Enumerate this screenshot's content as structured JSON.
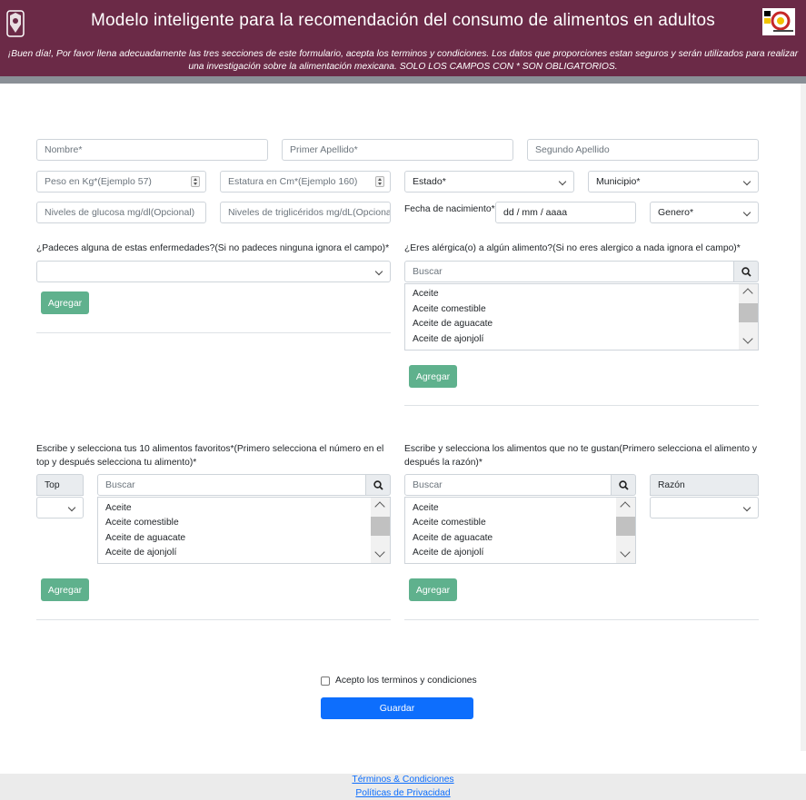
{
  "header": {
    "title": "Modelo inteligente para la recomendación del consumo de alimentos en adultos",
    "intro": "¡Buen día!, Por favor llena adecuadamente las tres secciones de este formulario, acepta los terminos y condiciones. Los datos que proporciones estan seguros y serán utilizados para realizar una investigación sobre la alimentación mexicana. SOLO LOS CAMPOS CON * SON OBLIGATORIOS."
  },
  "personal": {
    "nombre_placeholder": "Nombre*",
    "primer_apellido_placeholder": "Primer Apellido*",
    "segundo_apellido_placeholder": "Segundo Apellido",
    "peso_placeholder": "Peso en Kg*(Ejemplo 57)",
    "estatura_placeholder": "Estatura en Cm*(Ejemplo 160)",
    "estado": "Estado*",
    "municipio": "Municipio*",
    "glucosa_placeholder": "Niveles de glucosa mg/dl(Opcional)",
    "trigliceridos_placeholder": "Niveles de triglicéridos mg/dL(Opcional)",
    "fecha_label": "Fecha de nacimiento*",
    "fecha_value": "dd / mm / aaaa",
    "genero": "Genero*"
  },
  "enfermedades": {
    "label": "¿Padeces alguna de estas enfermedades?(Si no padeces ninguna ignora el campo)*",
    "selected": "",
    "add_button": "Agregar"
  },
  "alergias": {
    "label": "¿Eres alérgica(o) a algún alimento?(Si no eres alergico a nada ignora el campo)*",
    "search_placeholder": "Buscar",
    "options": [
      "Aceite",
      "Aceite comestible",
      "Aceite de aguacate",
      "Aceite de ajonjolí"
    ],
    "add_button": "Agregar"
  },
  "favoritos": {
    "label": "Escribe y selecciona tus 10 alimentos favoritos*(Primero selecciona el número en el top y después selecciona tu alimento)*",
    "top_header": "Top",
    "top_value": "",
    "search_placeholder": "Buscar",
    "options": [
      "Aceite",
      "Aceite comestible",
      "Aceite de aguacate",
      "Aceite de ajonjolí"
    ],
    "add_button": "Agregar"
  },
  "no_gustan": {
    "label": "Escribe y selecciona los alimentos que no te gustan(Primero selecciona el alimento y después la razón)*",
    "search_placeholder": "Buscar",
    "options": [
      "Aceite",
      "Aceite comestible",
      "Aceite de aguacate",
      "Aceite de ajonjolí"
    ],
    "razon_header": "Razón",
    "razon_value": "",
    "add_button": "Agregar"
  },
  "terms": {
    "checkbox_label": "Acepto los terminos y condiciones",
    "save_button": "Guardar"
  },
  "footer": {
    "terms_link": "Términos & Condiciones",
    "privacy_link": "Políticas de Privacidad"
  },
  "colors": {
    "header_bg": "#6b2a47",
    "green_button": "#5fb18d",
    "primary_button": "#0d6efd"
  }
}
